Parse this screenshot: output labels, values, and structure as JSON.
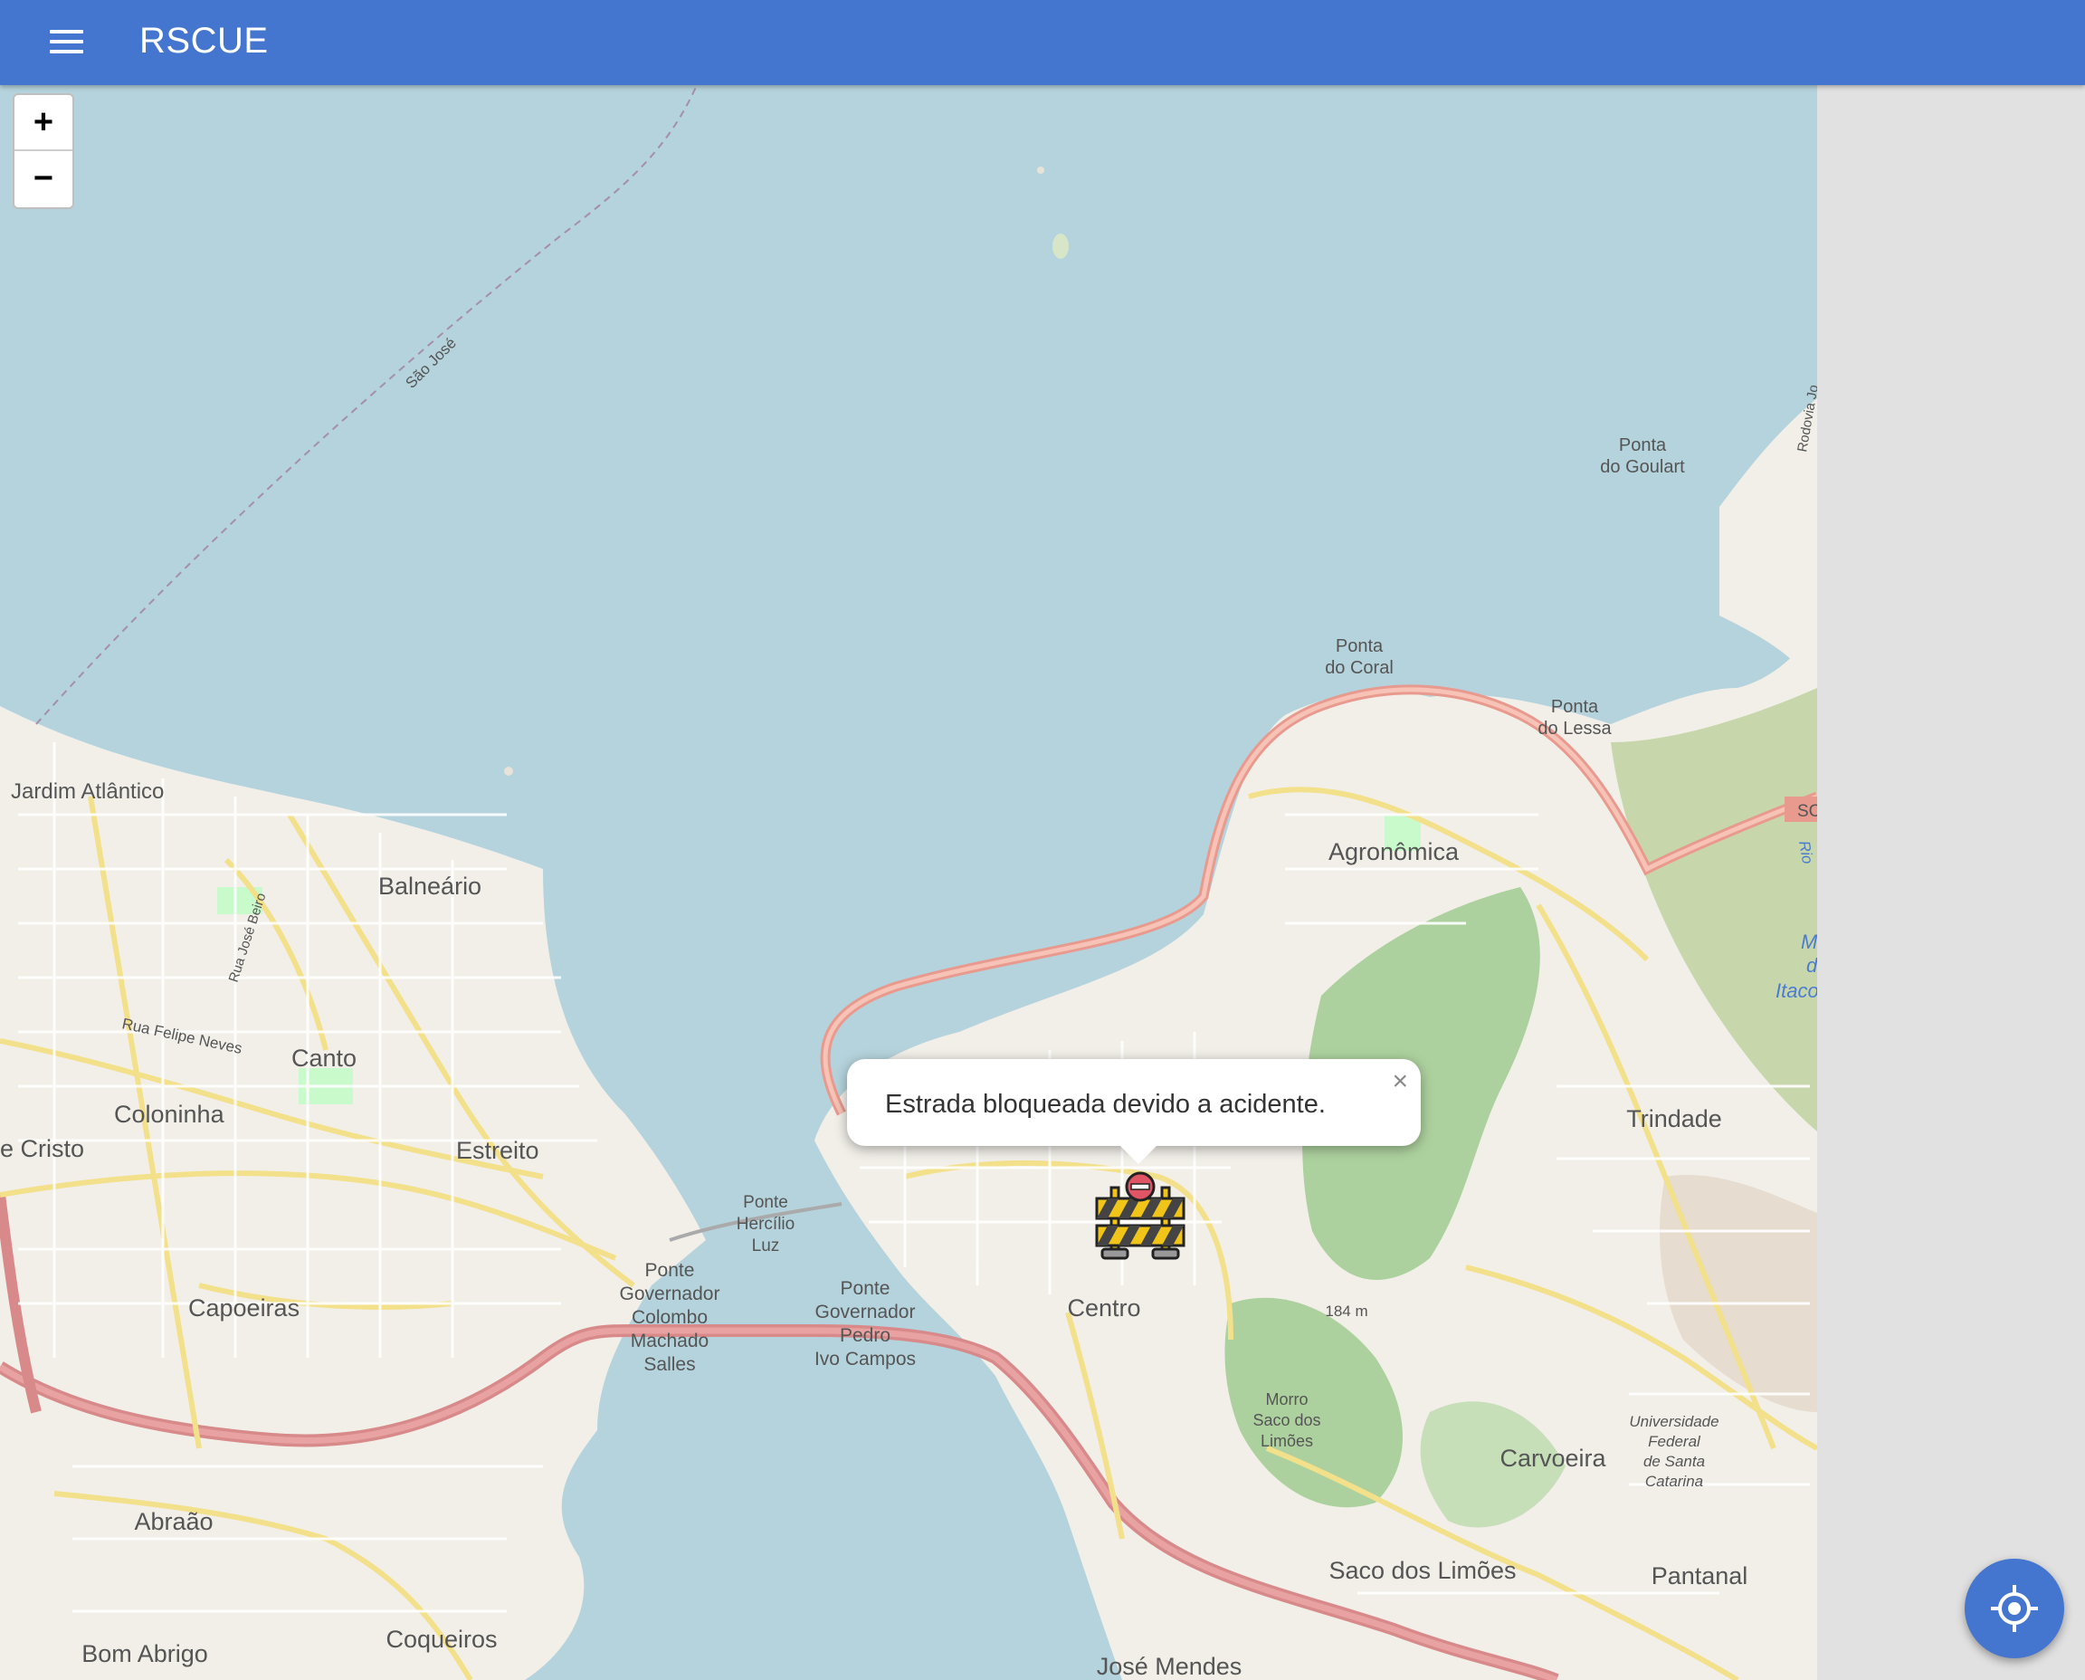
{
  "app": {
    "title": "RSCUE"
  },
  "zoom": {
    "in_label": "+",
    "out_label": "−"
  },
  "popup": {
    "text": "Estrada bloqueada devido a acidente.",
    "close_label": "×"
  },
  "map_labels": {
    "sao_jose": "São José",
    "ponta_goulart_1": "Ponta",
    "ponta_goulart_2": "do Goulart",
    "ponta_coral_1": "Ponta",
    "ponta_coral_2": "do Coral",
    "ponta_lessa_1": "Ponta",
    "ponta_lessa_2": "do Lessa",
    "jardim_atlantico": "Jardim Atlântico",
    "balneario": "Balneário",
    "agronomica": "Agronômica",
    "rua_jose_beiro": "Rua José Beiro",
    "rua_felipe_neves": "Rua Felipe Neves",
    "canto": "Canto",
    "coloninha": "Coloninha",
    "cristo": "e Cristo",
    "estreito": "Estreito",
    "trindade": "Trindade",
    "ponte_hercilio_1": "Ponte",
    "ponte_hercilio_2": "Hercílio",
    "ponte_hercilio_3": "Luz",
    "ponte_colombo_1": "Ponte",
    "ponte_colombo_2": "Governador",
    "ponte_colombo_3": "Colombo",
    "ponte_colombo_4": "Machado",
    "ponte_colombo_5": "Salles",
    "ponte_pedro_1": "Ponte",
    "ponte_pedro_2": "Governador",
    "ponte_pedro_3": "Pedro",
    "ponte_pedro_4": "Ivo Campos",
    "capoeiras": "Capoeiras",
    "centro": "Centro",
    "altitude": "184 m",
    "morro_1": "Morro",
    "morro_2": "Saco dos",
    "morro_3": "Limões",
    "carvoeira": "Carvoeira",
    "ufsc_1": "Universidade",
    "ufsc_2": "Federal",
    "ufsc_3": "de Santa",
    "ufsc_4": "Catarina",
    "abraao": "Abraão",
    "saco_limoes": "Saco dos Limões",
    "pantanal": "Pantanal",
    "bom_abrigo": "Bom Abrigo",
    "coqueiros": "Coqueiros",
    "jose_mendes": "José Mendes",
    "rodovia": "Rodovia Jo",
    "sc": "SC",
    "mar_1": "Mar",
    "mar_2": "do",
    "mar_3": "Itaco",
    "rio": "Rio"
  },
  "icons": {
    "menu": "menu-icon",
    "marker": "road-block-icon",
    "locate": "my-location-icon"
  },
  "colors": {
    "appbar": "#4576cf",
    "water": "#b5d3dc",
    "land": "#f2efe9",
    "highway": "#e89a8e",
    "road_major": "#f7f3a3",
    "forest": "#add19e"
  }
}
